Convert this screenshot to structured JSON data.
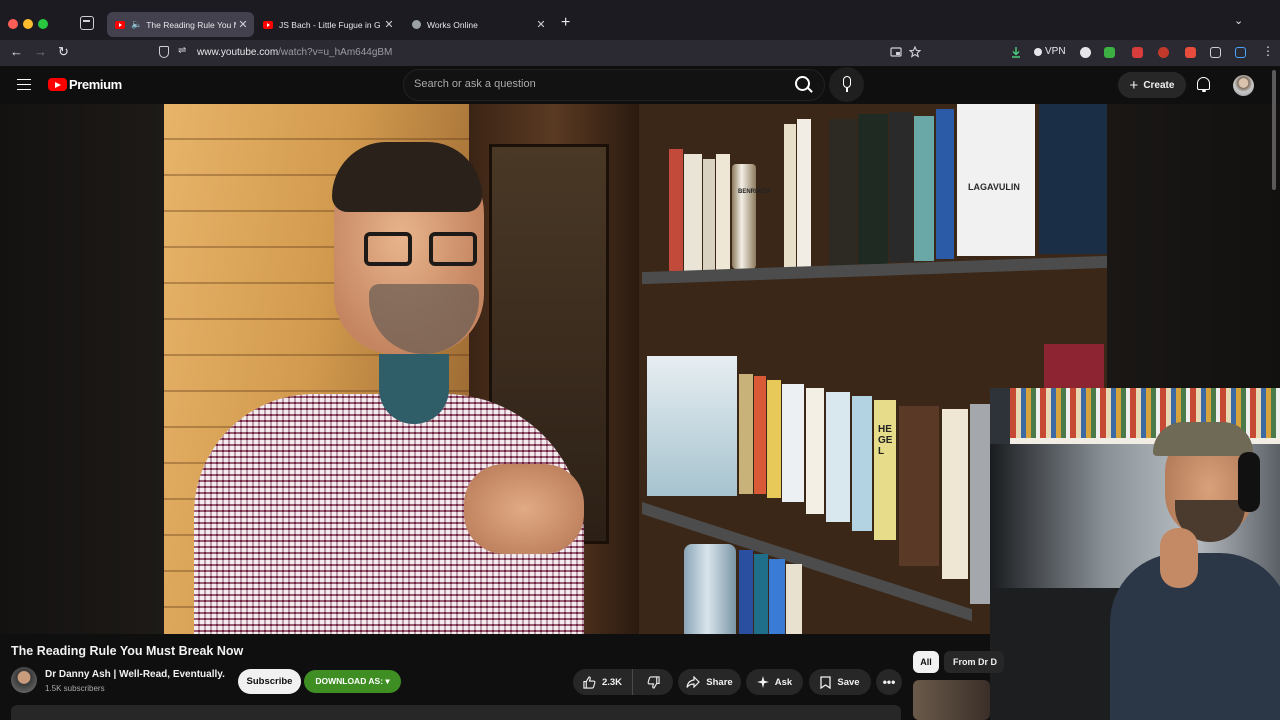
{
  "browser": {
    "tabs": [
      {
        "title": "The Reading Rule You Must",
        "active": true,
        "playing": true,
        "favicon": "youtube-icon"
      },
      {
        "title": "JS Bach - Little Fugue in G Mino",
        "active": false,
        "favicon": "youtube-icon"
      },
      {
        "title": "Works Online",
        "active": false,
        "favicon": "globe-icon"
      }
    ],
    "url_domain": "www.youtube.com",
    "url_path": "/watch?v=u_hAm644gBM",
    "vpn_label": "VPN"
  },
  "youtube": {
    "logo_text": "Premium",
    "search_placeholder": "Search or ask a question",
    "create_label": "Create"
  },
  "video": {
    "title": "The Reading Rule You Must Break Now",
    "channel_name": "Dr Danny Ash | Well-Read, Eventually.",
    "subscribers": "1.5K subscribers",
    "subscribe_label": "Subscribe",
    "download_label": "DOWNLOAD AS: ▾",
    "likes": "2.3K",
    "share_label": "Share",
    "ask_label": "Ask",
    "save_label": "Save",
    "more_label": "•••",
    "book_label_1": "LAGAVULIN",
    "book_label_2": "HEGEL",
    "book_label_3": "BENRIACH"
  },
  "sidebar": {
    "chips": [
      "All",
      "From Dr D"
    ]
  },
  "colors": {
    "youtube_red": "#ff0000",
    "download_green": "#3e8e24",
    "background": "#0f0f0f"
  }
}
